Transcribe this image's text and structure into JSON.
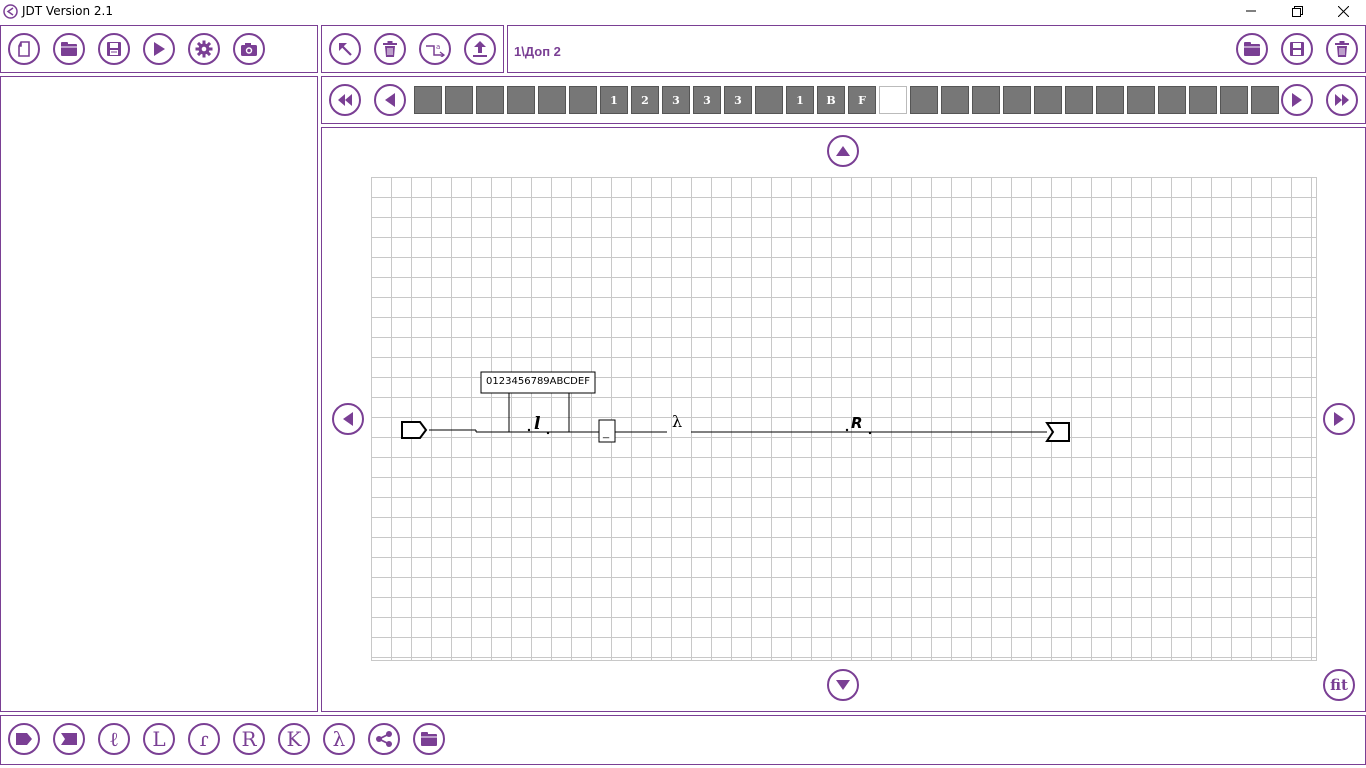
{
  "window": {
    "title": "JDT Version 2.1"
  },
  "header": {
    "path": "1\\Доп 2"
  },
  "toolbar_left": [
    "new-icon",
    "open-folder-icon",
    "save-icon",
    "play-icon",
    "gear-icon",
    "camera-icon"
  ],
  "toolbar_mid": [
    "pointer-icon",
    "trash-icon",
    "rename-icon",
    "upload-icon"
  ],
  "toolbar_right": [
    "open-folder-icon",
    "save-icon",
    "trash-icon"
  ],
  "tape": {
    "cells": [
      "",
      "",
      "",
      "",
      "",
      "",
      "1",
      "2",
      "3",
      "3",
      "3",
      "",
      "1",
      "B",
      "F",
      "",
      "",
      "",
      "",
      "",
      "",
      "",
      "",
      "",
      "",
      "",
      "",
      ""
    ],
    "head_index": 15
  },
  "diagram": {
    "alphabet_label": "0123456789ABCDEF",
    "node_l": "l",
    "node_lambda": "λ",
    "node_r": "R",
    "node_box": "_"
  },
  "bottom_toolbar": {
    "items": [
      {
        "icon": "start-tag-icon",
        "glyph": ""
      },
      {
        "icon": "end-tag-icon",
        "glyph": ""
      },
      {
        "icon": "l-script-icon",
        "glyph": "ℓ"
      },
      {
        "icon": "l-icon",
        "glyph": "L"
      },
      {
        "icon": "r-script-icon",
        "glyph": "ɾ"
      },
      {
        "icon": "r-icon",
        "glyph": "R"
      },
      {
        "icon": "k-icon",
        "glyph": "K"
      },
      {
        "icon": "lambda-icon",
        "glyph": "λ"
      },
      {
        "icon": "share-icon",
        "glyph": ""
      },
      {
        "icon": "open-folder-icon",
        "glyph": ""
      }
    ]
  },
  "canvas": {
    "fit_label": "fit"
  },
  "colors": {
    "accent": "#7a3f94",
    "cell": "#777777"
  }
}
